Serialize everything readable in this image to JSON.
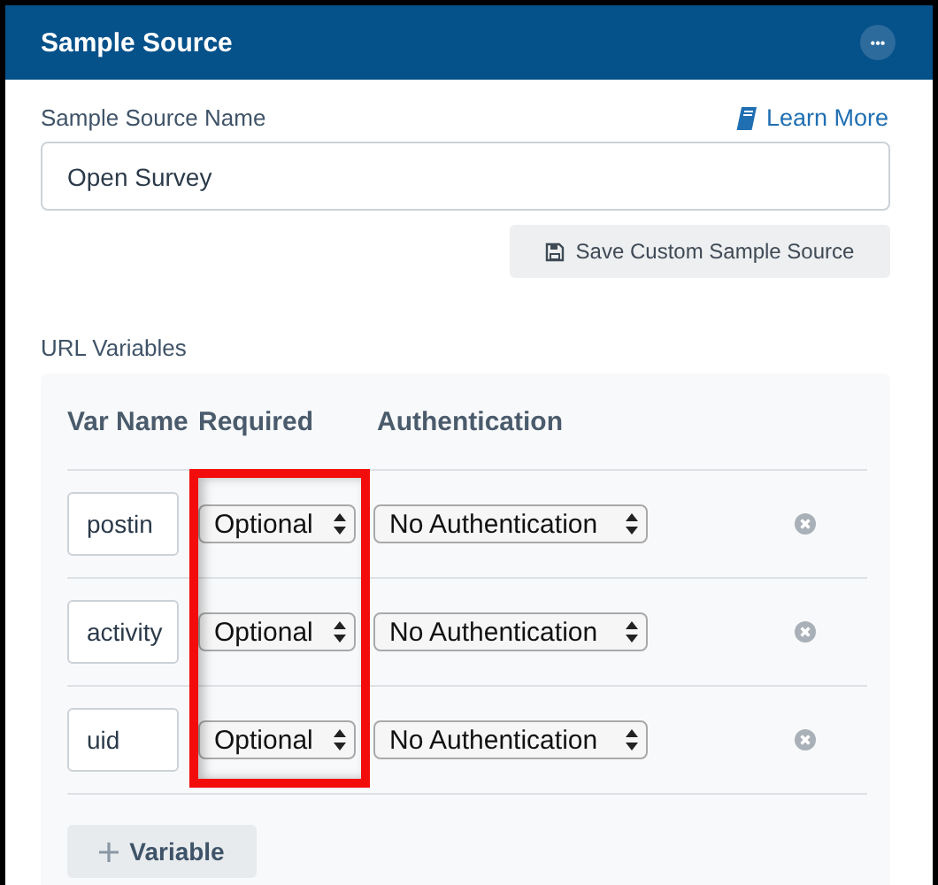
{
  "panel": {
    "title": "Sample Source",
    "menu_button": "•••"
  },
  "name_field": {
    "label": "Sample Source Name",
    "value": "Open Survey"
  },
  "learn_more": "Learn More",
  "save_button": "Save Custom Sample Source",
  "url_variables": {
    "label": "URL Variables",
    "columns": [
      "Var Name",
      "Required",
      "Authentication"
    ],
    "rows": [
      {
        "var_name": "postin",
        "required": "Optional",
        "authentication": "No Authentication"
      },
      {
        "var_name": "activity",
        "required": "Optional",
        "authentication": "No Authentication"
      },
      {
        "var_name": "uid",
        "required": "Optional",
        "authentication": "No Authentication"
      }
    ],
    "add_button": "Variable"
  },
  "annotations": [
    {
      "kind": "highlight-box"
    }
  ]
}
